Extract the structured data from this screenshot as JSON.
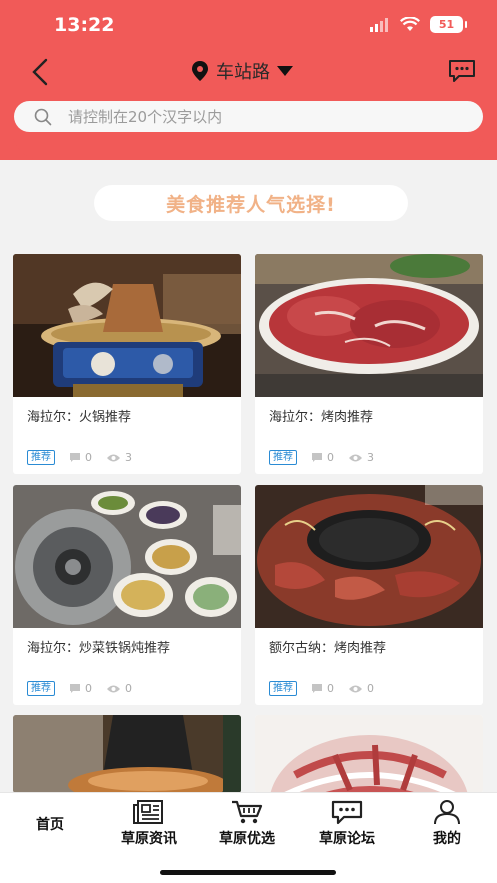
{
  "status": {
    "time": "13:22",
    "battery": "51"
  },
  "header": {
    "location": "车站路"
  },
  "search": {
    "placeholder": "请控制在20个汉字以内"
  },
  "banner": {
    "text": "美食推荐人气选择!"
  },
  "cards": [
    {
      "title": "海拉尔：火锅推荐",
      "tag": "推荐",
      "comments": "0",
      "views": "3"
    },
    {
      "title": "海拉尔：烤肉推荐",
      "tag": "推荐",
      "comments": "0",
      "views": "3"
    },
    {
      "title": "海拉尔：炒菜铁锅炖推荐",
      "tag": "推荐",
      "comments": "0",
      "views": "0"
    },
    {
      "title": "额尔古纳：烤肉推荐",
      "tag": "推荐",
      "comments": "0",
      "views": "0"
    }
  ],
  "tabs": [
    {
      "label": "首页",
      "icon": "home"
    },
    {
      "label": "草原资讯",
      "icon": "newspaper-icon"
    },
    {
      "label": "草原优选",
      "icon": "cart-icon"
    },
    {
      "label": "草原论坛",
      "icon": "chat-icon"
    },
    {
      "label": "我的",
      "icon": "user-icon"
    }
  ],
  "colors": {
    "primary": "#f15a58",
    "tag": "#2a8bd4",
    "banner_text": "#f1b287"
  }
}
